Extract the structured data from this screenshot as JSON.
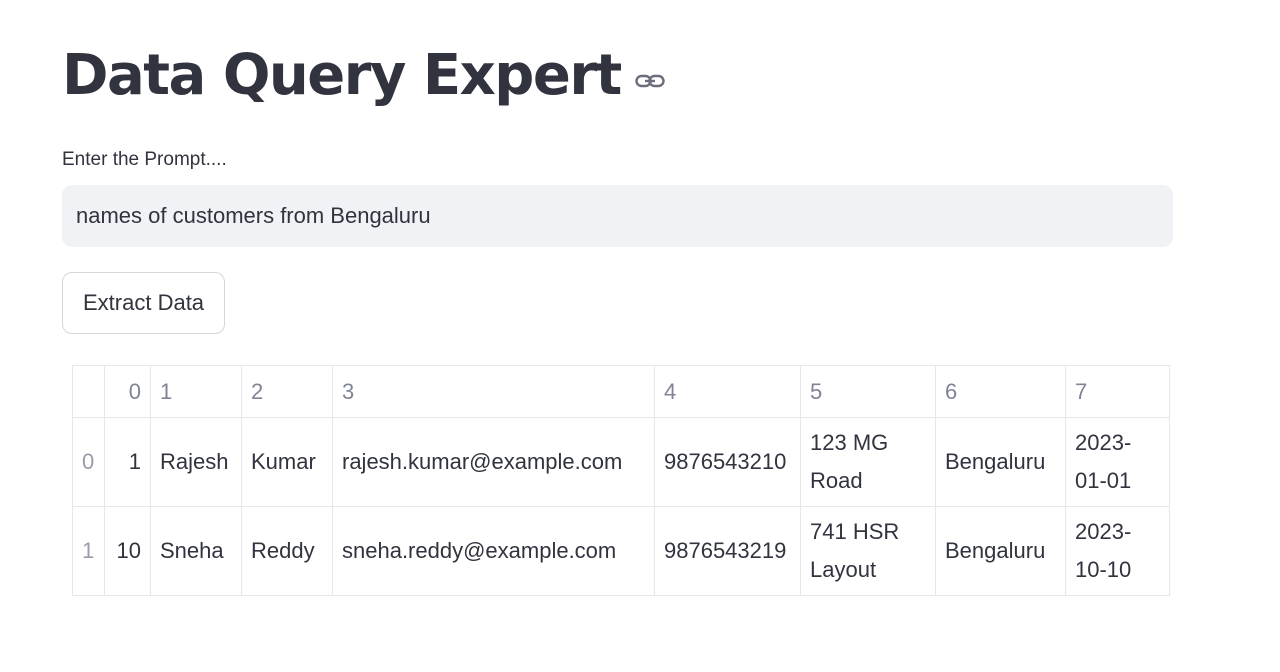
{
  "page": {
    "title": "Data Query Expert",
    "link_icon": "link-icon"
  },
  "prompt": {
    "label": "Enter the Prompt....",
    "value": "names of customers from Bengaluru"
  },
  "buttons": {
    "extract_label": "Extract Data"
  },
  "table": {
    "columns": [
      "",
      "0",
      "1",
      "2",
      "3",
      "4",
      "5",
      "6",
      "7"
    ],
    "rows": [
      {
        "index": "0",
        "cells": [
          "1",
          "Rajesh",
          "Kumar",
          "rajesh.kumar@example.com",
          "9876543210",
          "123 MG Road",
          "Bengaluru",
          "2023-01-01"
        ]
      },
      {
        "index": "1",
        "cells": [
          "10",
          "Sneha",
          "Reddy",
          "sneha.reddy@example.com",
          "9876543219",
          "741 HSR Layout",
          "Bengaluru",
          "2023-10-10"
        ]
      }
    ]
  },
  "colors": {
    "text": "#31333f",
    "input_bg": "#f0f2f6",
    "border": "#e6e7eb",
    "header_text": "#808495"
  }
}
